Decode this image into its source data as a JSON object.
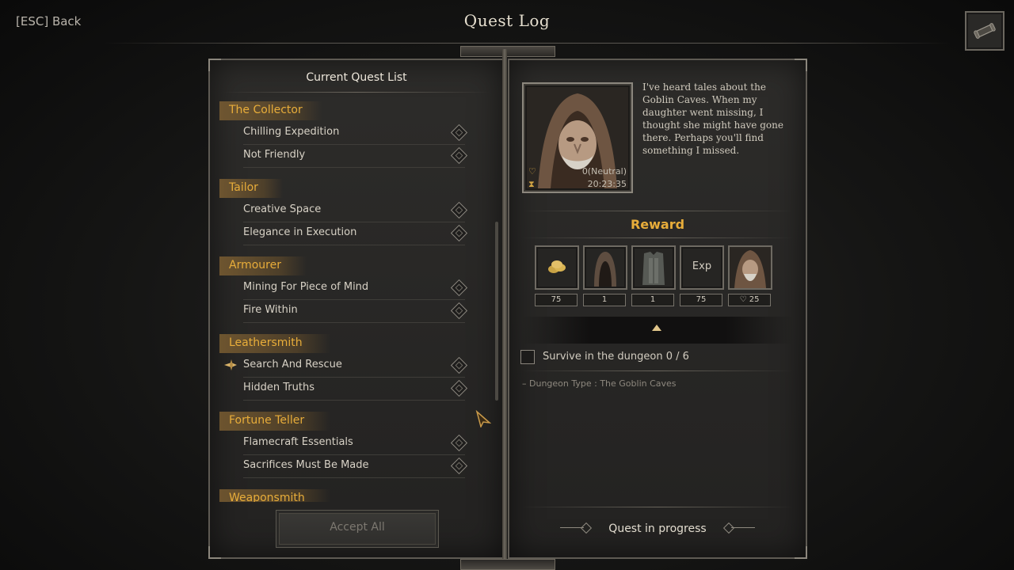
{
  "header": {
    "back_label": "[ESC] Back",
    "title": "Quest Log"
  },
  "quest_list": {
    "title": "Current Quest List",
    "categories": [
      {
        "name": "The Collector",
        "quests": [
          "Chilling Expedition",
          "Not Friendly"
        ]
      },
      {
        "name": "Tailor",
        "quests": [
          "Creative Space",
          "Elegance in Execution"
        ]
      },
      {
        "name": "Armourer",
        "quests": [
          "Mining For Piece of Mind",
          "Fire Within"
        ]
      },
      {
        "name": "Leathersmith",
        "quests": [
          "Search And Rescue",
          "Hidden Truths"
        ]
      },
      {
        "name": "Fortune Teller",
        "quests": [
          "Flamecraft Essentials",
          "Sacrifices Must Be Made"
        ]
      },
      {
        "name": "Weaponsmith",
        "quests": []
      }
    ],
    "selected_quest": "Search And Rescue",
    "accept_all_label": "Accept All"
  },
  "detail": {
    "affinity": "0(Neutral)",
    "timer": "20:23:35",
    "description": "I've heard tales about the Goblin Caves. When my daughter went missing, I thought she might have gone there. Perhaps you'll find something I missed.",
    "reward_title": "Reward",
    "rewards": [
      {
        "icon": "gold-coins-icon",
        "count": "75"
      },
      {
        "icon": "hood-icon",
        "count": "1"
      },
      {
        "icon": "armor-icon",
        "count": "1"
      },
      {
        "icon": "exp-icon",
        "label": "Exp",
        "count": "75"
      },
      {
        "icon": "npc-affinity-icon",
        "count": "♡ 25"
      }
    ],
    "objective": "Survive in the dungeon 0 / 6",
    "dungeon_type": "– Dungeon Type : The Goblin Caves",
    "status": "Quest in progress"
  },
  "colors": {
    "accent_gold": "#e8ad3a",
    "category_bg": "#966f37"
  }
}
